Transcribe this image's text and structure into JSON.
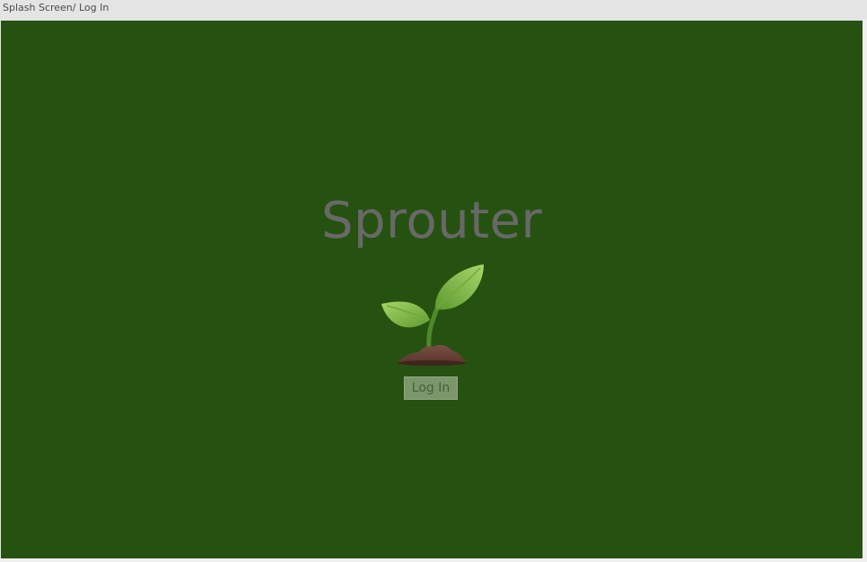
{
  "window": {
    "title": "Splash Screen/ Log In"
  },
  "splash": {
    "app_name": "Sprouter",
    "logo_icon": "seedling-icon",
    "login_label": "Log In"
  },
  "colors": {
    "background": "#255210",
    "title_text": "#686868",
    "button_bg": "#7a966a",
    "button_text": "#46603a"
  }
}
